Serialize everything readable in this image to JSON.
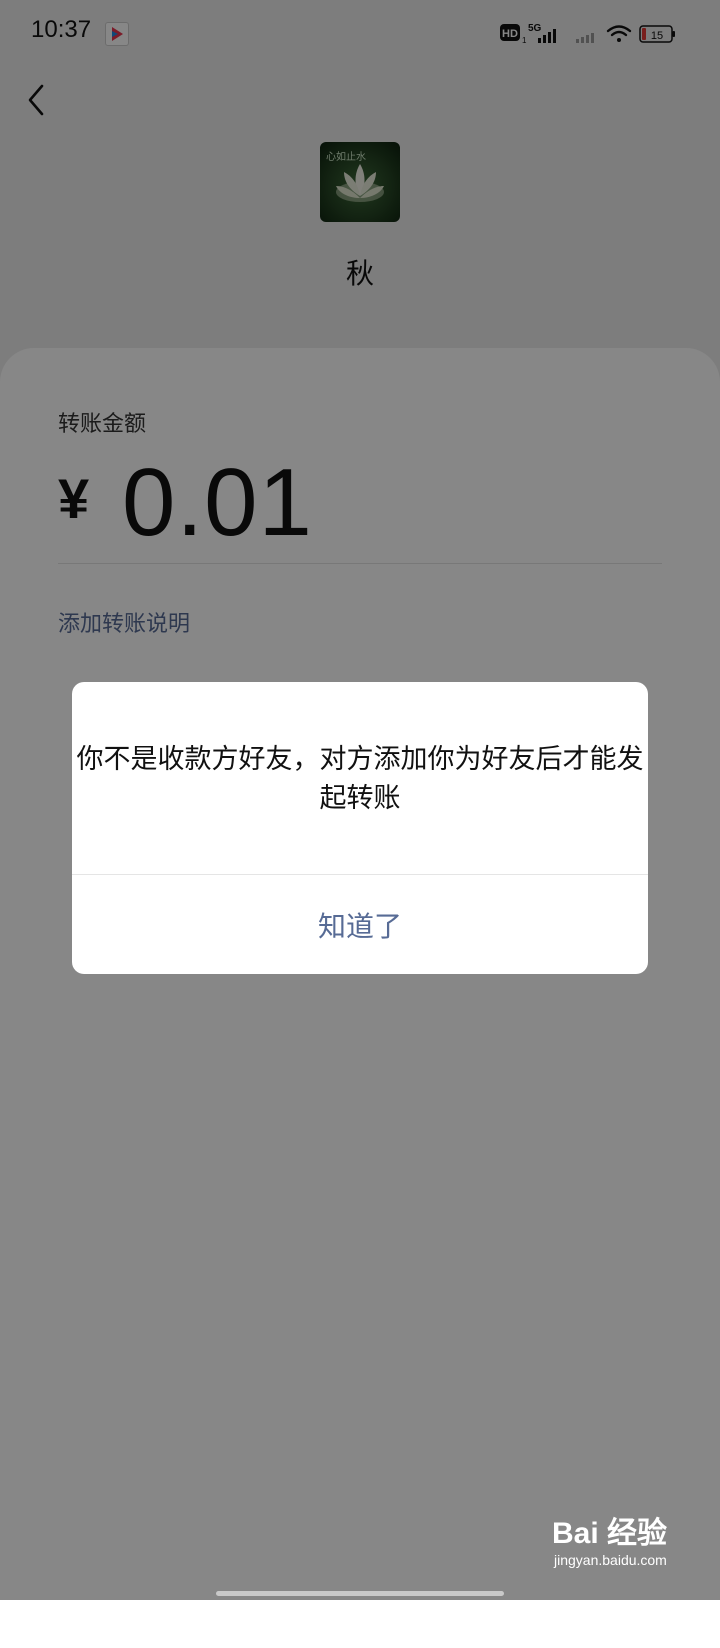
{
  "status_bar": {
    "time": "10:37",
    "network": "5G",
    "hd_label": "HD",
    "hd_sub": "1",
    "battery": "15",
    "icons": [
      "app-notification-icon",
      "hd-icon",
      "signal-icon",
      "wifi-icon",
      "battery-icon"
    ]
  },
  "nav": {
    "back_icon": "chevron-left-icon"
  },
  "payee": {
    "avatar_text": "心如止水",
    "name": "秋"
  },
  "transfer": {
    "label": "转账金额",
    "currency": "¥",
    "amount": "0.01",
    "add_note": "添加转账说明"
  },
  "dialog": {
    "message": "你不是收款方好友，对方添加你为好友后才能发起转账",
    "button": "知道了"
  },
  "watermark": {
    "logo": "Bai 经验",
    "url": "jingyan.baidu.com"
  },
  "colors": {
    "accent_link": "#576b95",
    "overlay": "rgba(0,0,0,0.47)",
    "battery_low": "#e53935"
  }
}
